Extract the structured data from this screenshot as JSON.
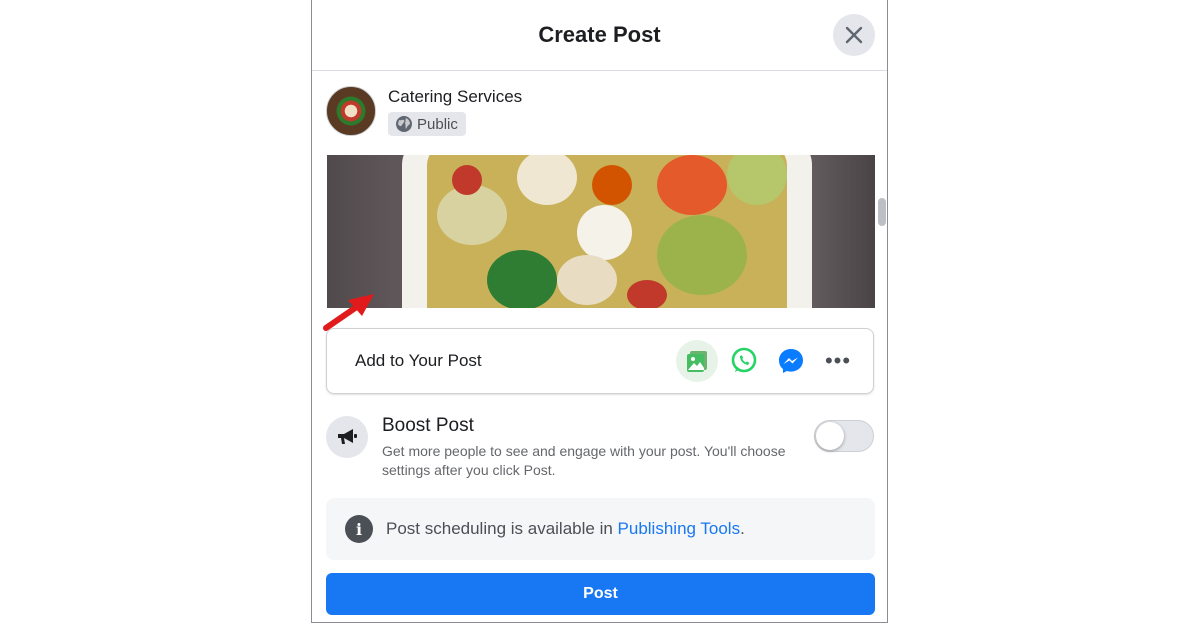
{
  "dialog": {
    "title": "Create Post",
    "close_icon": "close-icon"
  },
  "author": {
    "name": "Catering Services",
    "privacy_label": "Public",
    "privacy_icon": "globe-icon"
  },
  "add_to_post": {
    "label": "Add to Your Post",
    "icons": [
      "photo-video-icon",
      "whatsapp-icon",
      "messenger-icon",
      "more-options-icon"
    ],
    "more_label": "•••"
  },
  "boost": {
    "icon": "megaphone-icon",
    "title": "Boost Post",
    "description": "Get more people to see and engage with your post. You'll choose settings after you click Post.",
    "enabled": false
  },
  "notice": {
    "info_icon_glyph": "i",
    "text_prefix": "Post scheduling is available in ",
    "link": "Publishing Tools",
    "text_suffix": "."
  },
  "post_button": {
    "label": "Post"
  },
  "colors": {
    "primary": "#1877f2",
    "whatsapp": "#25d366",
    "annotation_arrow": "#e11b1b"
  }
}
